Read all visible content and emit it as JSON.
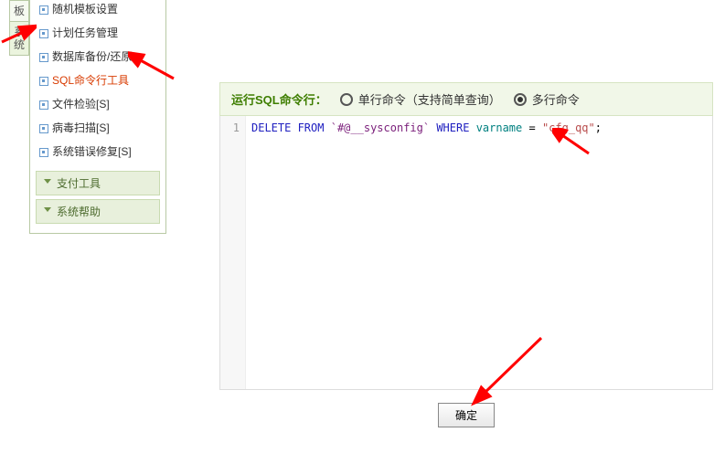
{
  "tabs": {
    "t1": "板",
    "t2": "系统"
  },
  "sidebar": {
    "items": [
      "随机模板设置",
      "计划任务管理",
      "数据库备份/还原",
      "SQL命令行工具",
      "文件检验[S]",
      "病毒扫描[S]",
      "系统错误修复[S]"
    ],
    "section_pay": "支付工具",
    "section_help": "系统帮助"
  },
  "header": {
    "title": "运行SQL命令行：",
    "opt_single": "单行命令（支持简单查询）",
    "opt_multi": "多行命令"
  },
  "code": {
    "line_num": "1",
    "kw_delete": "DELETE FROM",
    "tbl": "`#@__sysconfig`",
    "kw_where": "WHERE",
    "ident": "varname",
    "eq": " = ",
    "str": "\"cfg_qq\"",
    "semi": ";"
  },
  "buttons": {
    "ok": "确定"
  }
}
